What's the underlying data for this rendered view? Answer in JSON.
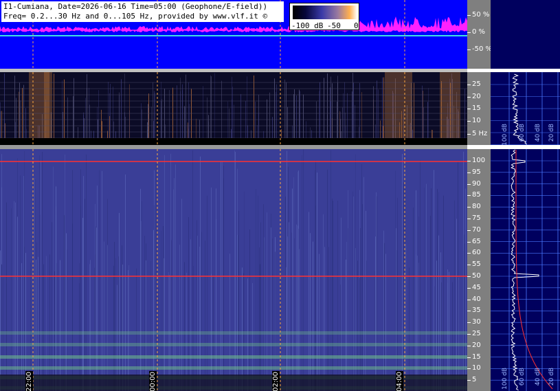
{
  "info": {
    "line1": "I1-Cumiana, Date=2026-06-16 Time=05:00 (Geophone/E-field))",
    "line2": "Freq= 0.2...30 Hz and 0...105 Hz, provided by www.vlf.it ©"
  },
  "legend": {
    "min_label": "-100 dB",
    "mid_label": "-50",
    "max_label": "0",
    "gradient_colors": [
      "#000000",
      "#06063a",
      "#3a3aa8",
      "#9a7aa0",
      "#ffb050",
      "#ffffff"
    ]
  },
  "top_axis": {
    "labels": [
      "50 %",
      "0 %",
      "-50 %"
    ]
  },
  "low_axis": {
    "labels": [
      "25",
      "20",
      "15",
      "10",
      "5 Hz"
    ]
  },
  "high_axis": {
    "labels": [
      "100",
      "95",
      "90",
      "85",
      "80",
      "75",
      "70",
      "65",
      "60",
      "55",
      "50",
      "45",
      "40",
      "35",
      "30",
      "25",
      "20",
      "15",
      "10",
      "5"
    ]
  },
  "time_labels": [
    "22:00",
    "00:00",
    "02:00",
    "04:00"
  ],
  "profile_low": {
    "labels": [
      "100 dB",
      "60 dB",
      "40 dB",
      "20 dB"
    ]
  },
  "profile_high": {
    "labels": [
      "100 dB",
      "60 dB",
      "40 dB",
      "20 dB"
    ]
  },
  "colors": {
    "top_background": "#0000ff",
    "top_signal": "#ff20ff",
    "spectrogram_low": "#0b0b26",
    "spectrogram_high": "#3a3e97",
    "time_marker": "#ffa940",
    "mains_line": "#ff3030",
    "profile_background": "#00005e",
    "grid_line": "#4a78ff"
  }
}
